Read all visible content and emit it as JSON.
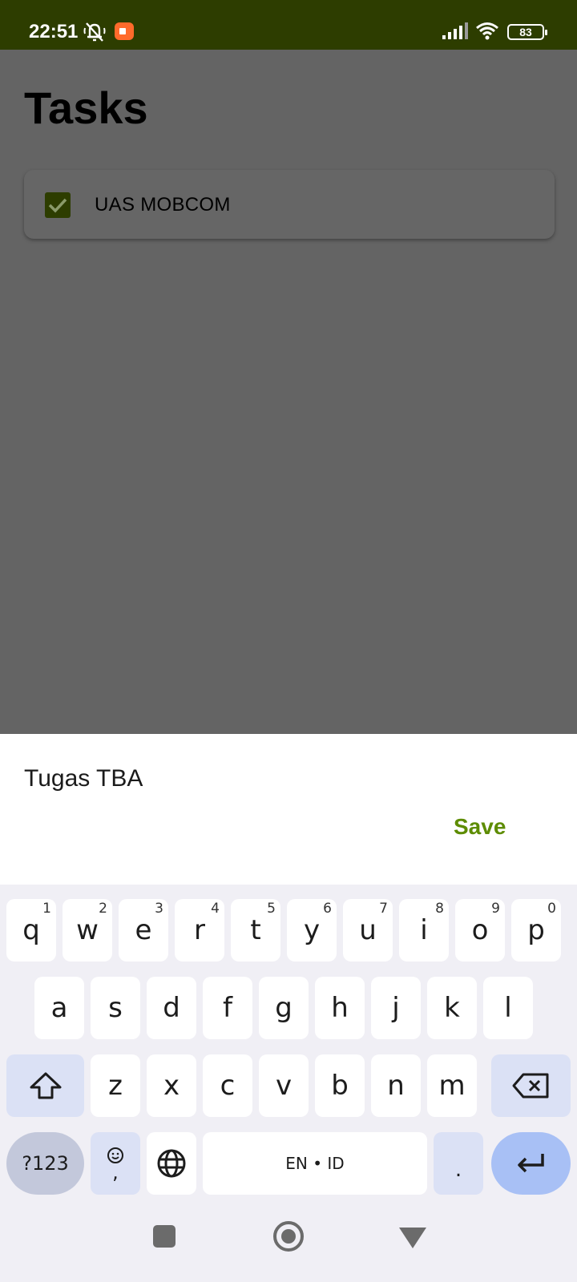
{
  "status_bar": {
    "time": "22:51",
    "battery": "83"
  },
  "page": {
    "title": "Tasks"
  },
  "tasks": [
    {
      "label": "UAS MOBCOM",
      "checked": true
    }
  ],
  "sheet": {
    "input_value": "Tugas TBA",
    "save_label": "Save"
  },
  "keyboard": {
    "row1": [
      {
        "key": "q",
        "hint": "1"
      },
      {
        "key": "w",
        "hint": "2"
      },
      {
        "key": "e",
        "hint": "3"
      },
      {
        "key": "r",
        "hint": "4"
      },
      {
        "key": "t",
        "hint": "5"
      },
      {
        "key": "y",
        "hint": "6"
      },
      {
        "key": "u",
        "hint": "7"
      },
      {
        "key": "i",
        "hint": "8"
      },
      {
        "key": "o",
        "hint": "9"
      },
      {
        "key": "p",
        "hint": "0"
      }
    ],
    "row2": [
      "a",
      "s",
      "d",
      "f",
      "g",
      "h",
      "j",
      "k",
      "l"
    ],
    "row3": [
      "z",
      "x",
      "c",
      "v",
      "b",
      "n",
      "m"
    ],
    "symbols_label": "?123",
    "emoji_sub": ",",
    "space_label": "EN • ID",
    "period_label": "."
  },
  "colors": {
    "status_bar": "#2d3d00",
    "accent": "#5d8c00",
    "checkbox": "#2d3d00",
    "scrim": "#646464"
  },
  "icons": [
    "bell-off-icon",
    "screen-record-icon",
    "signal-icon",
    "wifi-icon",
    "battery-icon",
    "check-icon",
    "shift-icon",
    "backspace-icon",
    "emoji-icon",
    "globe-icon",
    "enter-icon",
    "recents-icon",
    "home-icon",
    "back-icon"
  ]
}
